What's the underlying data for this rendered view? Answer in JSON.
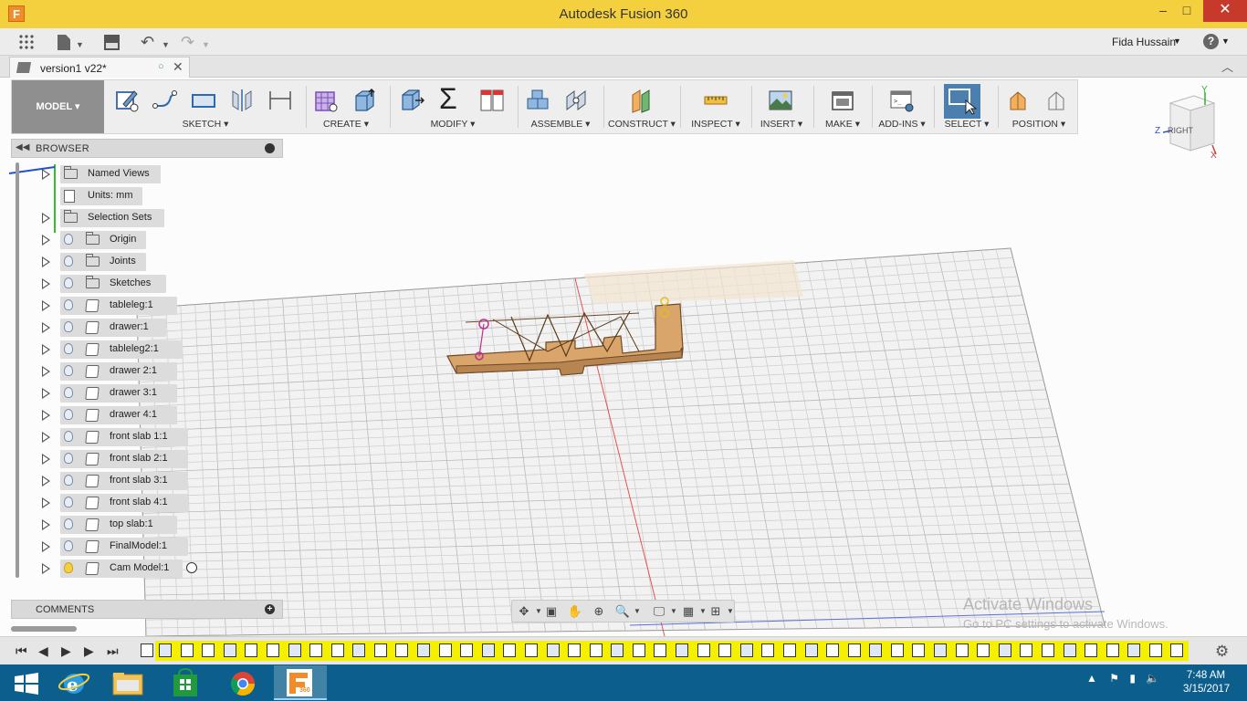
{
  "window": {
    "title": "Autodesk Fusion 360",
    "logo_letter": "F",
    "minimize": "–",
    "maximize": "□",
    "close": "✕"
  },
  "appbar": {
    "user_name": "Fida Hussain",
    "help": "?"
  },
  "document_tab": {
    "label": "version1 v22*",
    "close": "✕"
  },
  "toolbar": {
    "workspace": "MODEL",
    "groups": [
      {
        "key": "sketch",
        "label": "SKETCH"
      },
      {
        "key": "create",
        "label": "CREATE"
      },
      {
        "key": "modify",
        "label": "MODIFY"
      },
      {
        "key": "assemble",
        "label": "ASSEMBLE"
      },
      {
        "key": "construct",
        "label": "CONSTRUCT"
      },
      {
        "key": "inspect",
        "label": "INSPECT"
      },
      {
        "key": "insert",
        "label": "INSERT"
      },
      {
        "key": "make",
        "label": "MAKE"
      },
      {
        "key": "addins",
        "label": "ADD-INS"
      },
      {
        "key": "select",
        "label": "SELECT"
      },
      {
        "key": "position",
        "label": "POSITION"
      }
    ]
  },
  "browser": {
    "title": "BROWSER",
    "items": [
      {
        "label": "Named Views",
        "kind": "folder",
        "bulb": false
      },
      {
        "label": "Units: mm",
        "kind": "doc",
        "bulb": false,
        "no_expander": true
      },
      {
        "label": "Selection Sets",
        "kind": "folder",
        "bulb": false
      },
      {
        "label": "Origin",
        "kind": "folder",
        "bulb": true
      },
      {
        "label": "Joints",
        "kind": "folder",
        "bulb": true
      },
      {
        "label": "Sketches",
        "kind": "folder",
        "bulb": true
      },
      {
        "label": "tableleg:1",
        "kind": "comp",
        "bulb": true
      },
      {
        "label": "drawer:1",
        "kind": "comp",
        "bulb": true
      },
      {
        "label": "tableleg2:1",
        "kind": "comp",
        "bulb": true
      },
      {
        "label": "drawer 2:1",
        "kind": "comp",
        "bulb": true
      },
      {
        "label": "drawer 3:1",
        "kind": "comp",
        "bulb": true
      },
      {
        "label": "drawer 4:1",
        "kind": "comp",
        "bulb": true
      },
      {
        "label": "front slab 1:1",
        "kind": "comp",
        "bulb": true
      },
      {
        "label": "front slab 2:1",
        "kind": "comp",
        "bulb": true
      },
      {
        "label": "front slab 3:1",
        "kind": "comp",
        "bulb": true
      },
      {
        "label": "front slab 4:1",
        "kind": "comp",
        "bulb": true
      },
      {
        "label": "top slab:1",
        "kind": "comp",
        "bulb": true
      },
      {
        "label": "FinalModel:1",
        "kind": "asm",
        "bulb": true
      },
      {
        "label": "Cam Model:1",
        "kind": "asm",
        "bulb": true,
        "bulb_on": true,
        "radio": true
      }
    ]
  },
  "comments": {
    "title": "COMMENTS",
    "add": "+"
  },
  "viewcube": {
    "face": "RIGHT",
    "axis_y": "Y",
    "axis_z": "Z",
    "axis_x": "X"
  },
  "watermark": {
    "title": "Activate Windows",
    "subtitle": "Go to PC settings to activate Windows."
  },
  "timeline": {
    "feature_count": 48
  },
  "taskbar": {
    "fusion_badge": "360",
    "time": "7:48 AM",
    "date": "3/15/2017"
  },
  "colors": {
    "title_bar": "#f4d03f",
    "model_wood": "#d9a56a",
    "timeline_track": "#f4f000",
    "taskbar": "#0c5f8c",
    "close_button": "#c7392b",
    "select_active": "#4a7fb0"
  }
}
